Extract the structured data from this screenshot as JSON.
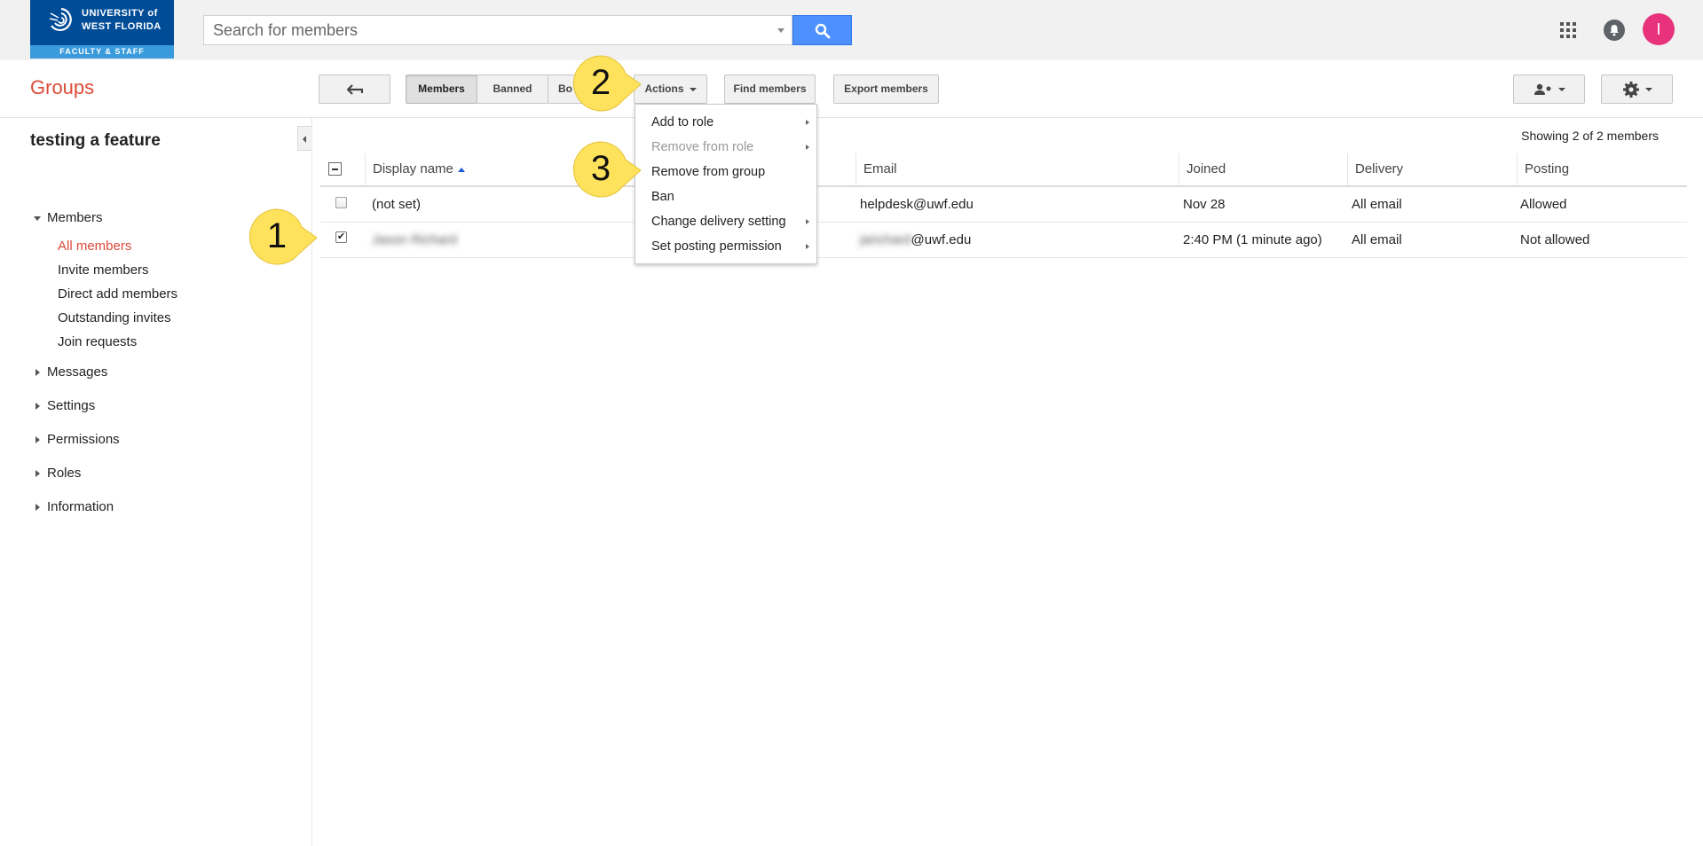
{
  "header": {
    "logo": {
      "line1": "UNIVERSITY of",
      "line2": "WEST FLORIDA",
      "subtitle": "FACULTY & STAFF",
      "brand_color": "#004c97",
      "accent_color": "#3a9bdc"
    },
    "search": {
      "placeholder": "Search for members",
      "button_icon": "search-icon"
    },
    "apps_icon": "apps-grid-icon",
    "notifications_icon": "bell-icon",
    "avatar_initial": "I",
    "avatar_color": "#e8327c"
  },
  "toolbar": {
    "app_title": "Groups",
    "back_icon": "back-arrow-icon",
    "tabs": [
      {
        "label": "Members",
        "active": true
      },
      {
        "label": "Banned",
        "active": false
      },
      {
        "label": "Bo",
        "active": false
      }
    ],
    "actions_label": "Actions",
    "find_members_label": "Find members",
    "export_members_label": "Export members",
    "add_member_icon": "add-person-icon",
    "settings_icon": "gear-icon"
  },
  "sidebar": {
    "group_name": "testing a feature",
    "sections": [
      {
        "label": "Members",
        "expanded": true
      },
      {
        "label": "Messages",
        "expanded": false
      },
      {
        "label": "Settings",
        "expanded": false
      },
      {
        "label": "Permissions",
        "expanded": false
      },
      {
        "label": "Roles",
        "expanded": false
      },
      {
        "label": "Information",
        "expanded": false
      }
    ],
    "member_items": [
      {
        "label": "All members",
        "selected": true
      },
      {
        "label": "Invite members",
        "selected": false
      },
      {
        "label": "Direct add members",
        "selected": false
      },
      {
        "label": "Outstanding invites",
        "selected": false
      },
      {
        "label": "Join requests",
        "selected": false
      }
    ]
  },
  "table": {
    "showing": "Showing 2 of 2 members",
    "columns": [
      "Display name",
      "Email",
      "Joined",
      "Delivery",
      "Posting"
    ],
    "rows": [
      {
        "checked": false,
        "display_name": "(not set)",
        "email": "helpdesk@uwf.edu",
        "joined": "Nov 28",
        "delivery": "All email",
        "posting": "Allowed"
      },
      {
        "checked": true,
        "display_name": "Jason Richard",
        "email_prefix": "jarichard",
        "email_suffix": "@uwf.edu",
        "joined": "2:40 PM (1 minute ago)",
        "delivery": "All email",
        "posting": "Not allowed"
      }
    ]
  },
  "actions_menu": {
    "items": [
      {
        "label": "Add to role",
        "submenu": true,
        "disabled": false
      },
      {
        "label": "Remove from role",
        "submenu": true,
        "disabled": true
      },
      {
        "label": "Remove from group",
        "submenu": false,
        "disabled": false
      },
      {
        "label": "Ban",
        "submenu": false,
        "disabled": false
      },
      {
        "label": "Change delivery setting",
        "submenu": true,
        "disabled": false
      },
      {
        "label": "Set posting permission",
        "submenu": true,
        "disabled": false
      }
    ]
  },
  "callouts": {
    "color": "#ffe25b",
    "steps": [
      "1",
      "2",
      "3"
    ]
  }
}
